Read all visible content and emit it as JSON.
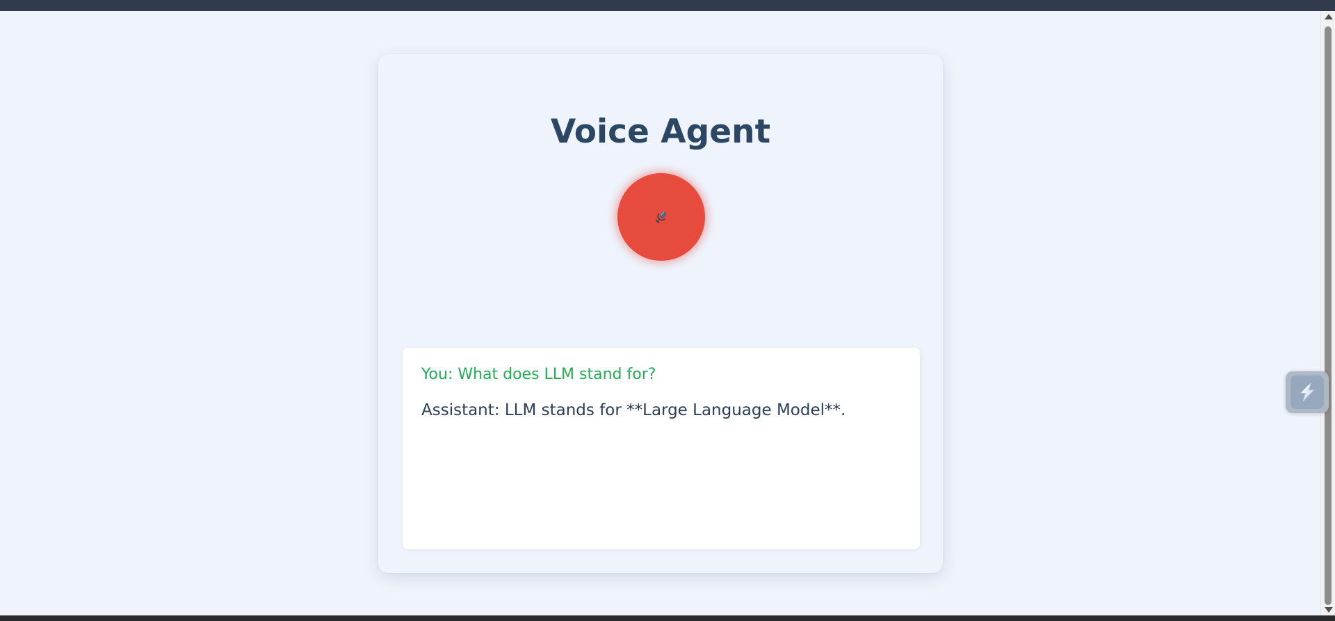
{
  "page": {
    "title": "Voice Agent"
  },
  "mic": {
    "icon": "microphone-icon",
    "state": "recording",
    "color": "#e64b3d"
  },
  "transcript": {
    "messages": [
      {
        "role": "user",
        "text": "You: What does LLM stand for?",
        "color": "#22ac55"
      },
      {
        "role": "assistant",
        "text": "Assistant: LLM stands for **Large Language Model**.",
        "color": "#2c3e57"
      }
    ]
  },
  "widget": {
    "icon": "extension-lightning-icon"
  },
  "colors": {
    "background": "#eef3fc",
    "title": "#2c4763",
    "top_bar": "#323b4e"
  }
}
